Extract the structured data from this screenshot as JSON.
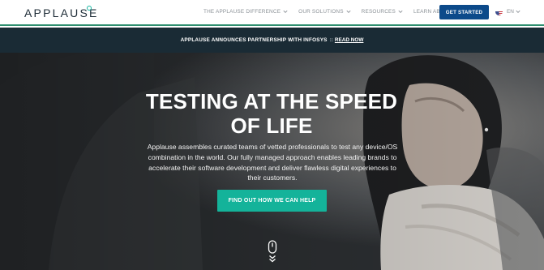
{
  "brand": {
    "logo_text": "APPLAUSE"
  },
  "nav": {
    "items": [
      {
        "label": "THE APPLAUSE DIFFERENCE"
      },
      {
        "label": "OUR SOLUTIONS"
      },
      {
        "label": "RESOURCES"
      },
      {
        "label": "LEARN ABOUT US"
      }
    ],
    "cta_label": "GET STARTED",
    "language": "EN"
  },
  "announcement": {
    "text": "APPLAUSE ANNOUNCES PARTNERSHIP WITH INFOSYS",
    "separator": "::",
    "link_label": "READ NOW"
  },
  "hero": {
    "title": "TESTING AT THE SPEED OF LIFE",
    "body": "Applause assembles curated teams of vetted professionals to test any device/OS combination in the world. Our fully managed approach enables leading brands to accelerate their software development and deliver flawless digital experiences to their customers.",
    "button_label": "FIND OUT HOW WE CAN HELP"
  },
  "colors": {
    "brand_navy": "#0c4a8a",
    "accent_teal": "#14b39a",
    "announce_bg": "#1a2b35"
  },
  "icons": {
    "logo_dot": "ring-icon",
    "nav_chevron": "chevron-down-icon",
    "language_flag": "us-flag-icon",
    "scroll": "mouse-scroll-icon"
  }
}
